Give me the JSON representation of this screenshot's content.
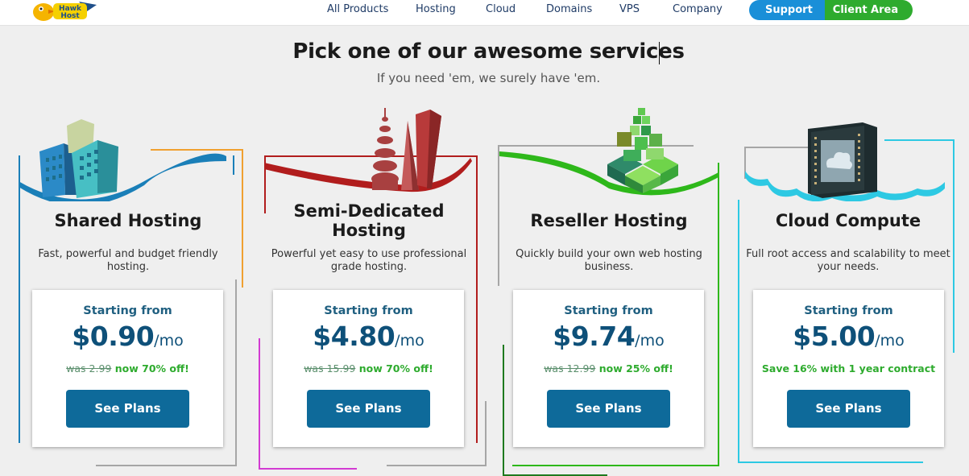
{
  "header": {
    "logo_alt": "Hawk Host",
    "nav": [
      "All Products",
      "Hosting",
      "Cloud",
      "Domains",
      "VPS",
      "Company"
    ],
    "support_label": "Support",
    "client_label": "Client Area"
  },
  "hero": {
    "title": "Pick one of our awesome services",
    "subtitle": "If you need 'em, we surely have 'em."
  },
  "colors": {
    "shared": "#1a7fb8",
    "shared_accent": "#f0a030",
    "semi": "#b11d1d",
    "semi_accent": "#d23bd2",
    "reseller": "#2eb81a",
    "reseller_accent": "#1f7a1f",
    "cloud": "#2dc9e3",
    "button": "#0e6a9a"
  },
  "cards": [
    {
      "title_line1": "Shared Hosting",
      "title_line2": "",
      "desc_line1": "Fast, powerful and budget friendly",
      "desc_line2": "hosting.",
      "starting": "Starting from",
      "price": "$0.90",
      "per": "/mo",
      "was": "was 2.99",
      "deal": "now 70% off!",
      "button": "See Plans",
      "icon": "office-buildings-icon"
    },
    {
      "title_line1": "Semi-Dedicated",
      "title_line2": "Hosting",
      "desc_line1": "Powerful yet easy to use professional",
      "desc_line2": "grade hosting.",
      "starting": "Starting from",
      "price": "$4.80",
      "per": "/mo",
      "was": "was 15.99",
      "deal": "now 70% off!",
      "button": "See Plans",
      "icon": "skyscrapers-icon"
    },
    {
      "title_line1": "Reseller Hosting",
      "title_line2": "",
      "desc_line1": "Quickly build your own web hosting",
      "desc_line2": "business.",
      "starting": "Starting from",
      "price": "$9.74",
      "per": "/mo",
      "was": "was 12.99",
      "deal": "now 25% off!",
      "button": "See Plans",
      "icon": "green-cubes-icon"
    },
    {
      "title_line1": "Cloud Compute",
      "title_line2": "",
      "desc_line1": "Full root access and scalability to meet",
      "desc_line2": "your needs.",
      "starting": "Starting from",
      "price": "$5.00",
      "per": "/mo",
      "was": "",
      "deal": "Save 16% with 1 year contract",
      "button": "See Plans",
      "icon": "cloud-chip-icon"
    }
  ]
}
